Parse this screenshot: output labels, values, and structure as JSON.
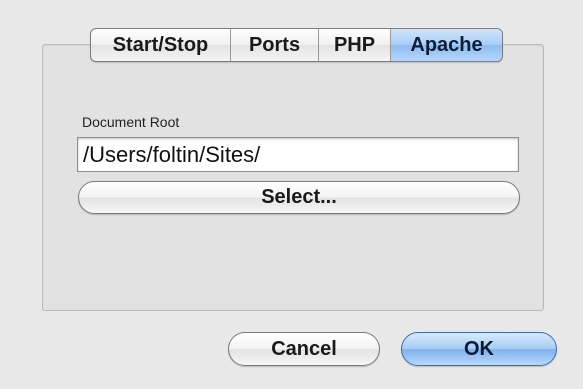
{
  "tabs": [
    {
      "label": "Start/Stop",
      "selected": false
    },
    {
      "label": "Ports",
      "selected": false
    },
    {
      "label": "PHP",
      "selected": false
    },
    {
      "label": "Apache",
      "selected": true
    }
  ],
  "apache": {
    "document_root_label": "Document Root",
    "document_root_value": "/Users/foltin/Sites/",
    "select_button_label": "Select..."
  },
  "footer": {
    "cancel_label": "Cancel",
    "ok_label": "OK"
  },
  "colors": {
    "selected_tab": "#a9cdf5",
    "default_button": "#7fb1ee",
    "window_background": "#e8e8e8"
  }
}
